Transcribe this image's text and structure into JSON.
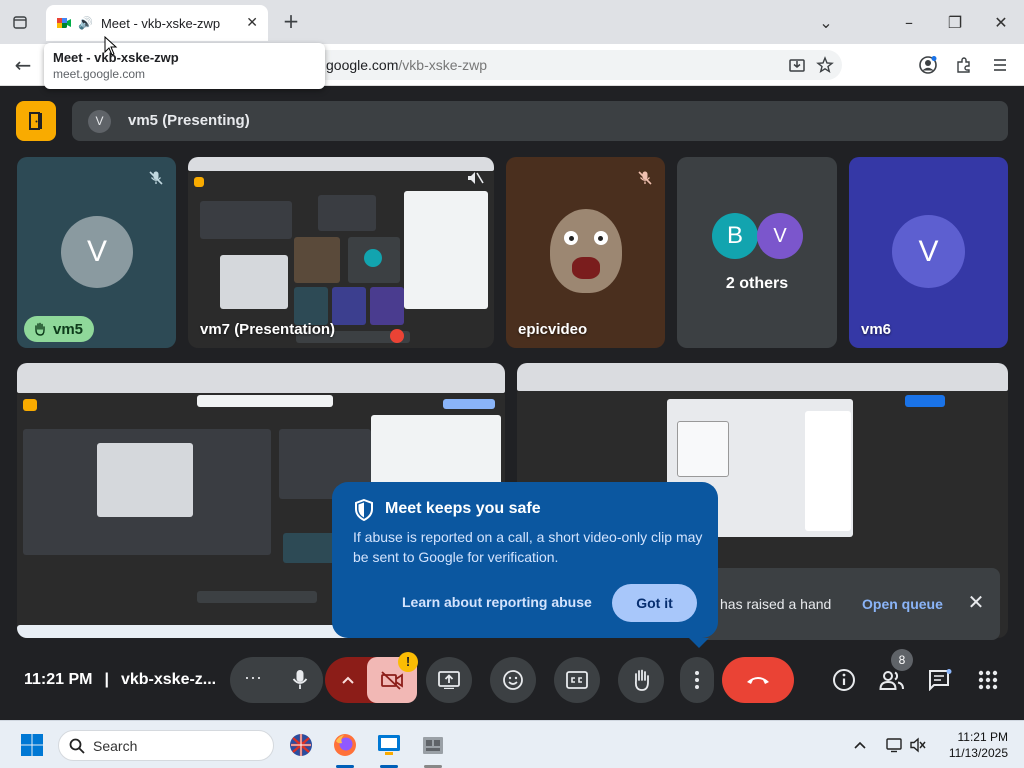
{
  "browser": {
    "tab_title": "Meet - vkb-xske-zwp",
    "url_domain": "google.com",
    "url_path": "/vkb-xske-zwp",
    "tooltip_title": "Meet - vkb-xske-zwp",
    "tooltip_url": "meet.google.com"
  },
  "meet": {
    "presenting_initial": "V",
    "presenting_label": "vm5 (Presenting)",
    "tiles": {
      "vm5": {
        "initial": "V",
        "name": "vm5"
      },
      "vm7": {
        "name": "vm7 (Presentation)"
      },
      "epicvideo": {
        "name": "epicvideo"
      },
      "others": {
        "initial_1": "B",
        "initial_2": "V",
        "label": "2 others"
      },
      "vm6": {
        "initial": "V",
        "name": "vm6"
      }
    }
  },
  "safe_popup": {
    "title": "Meet keeps you safe",
    "body": "If abuse is reported on a call, a short video-only clip may be sent to Google for verification.",
    "link": "Learn about reporting abuse",
    "button": "Got it"
  },
  "hand_toast": {
    "text": "has raised a hand",
    "action": "Open queue"
  },
  "controls": {
    "time": "11:21 PM",
    "meeting_code": "vkb-xske-z...",
    "separator": "|",
    "people_count": "8",
    "warning": "!"
  },
  "taskbar": {
    "search_placeholder": "Search",
    "time": "11:21 PM",
    "date": "11/13/2025"
  },
  "colors": {
    "meet_bg": "#202124",
    "tile_bg": "#3c4043",
    "exit_yellow": "#f9ab00",
    "popup_blue": "#0b57a0",
    "end_call_red": "#ea4335",
    "avatar_teal": "#12a4af",
    "avatar_purple": "#7b56cc"
  }
}
